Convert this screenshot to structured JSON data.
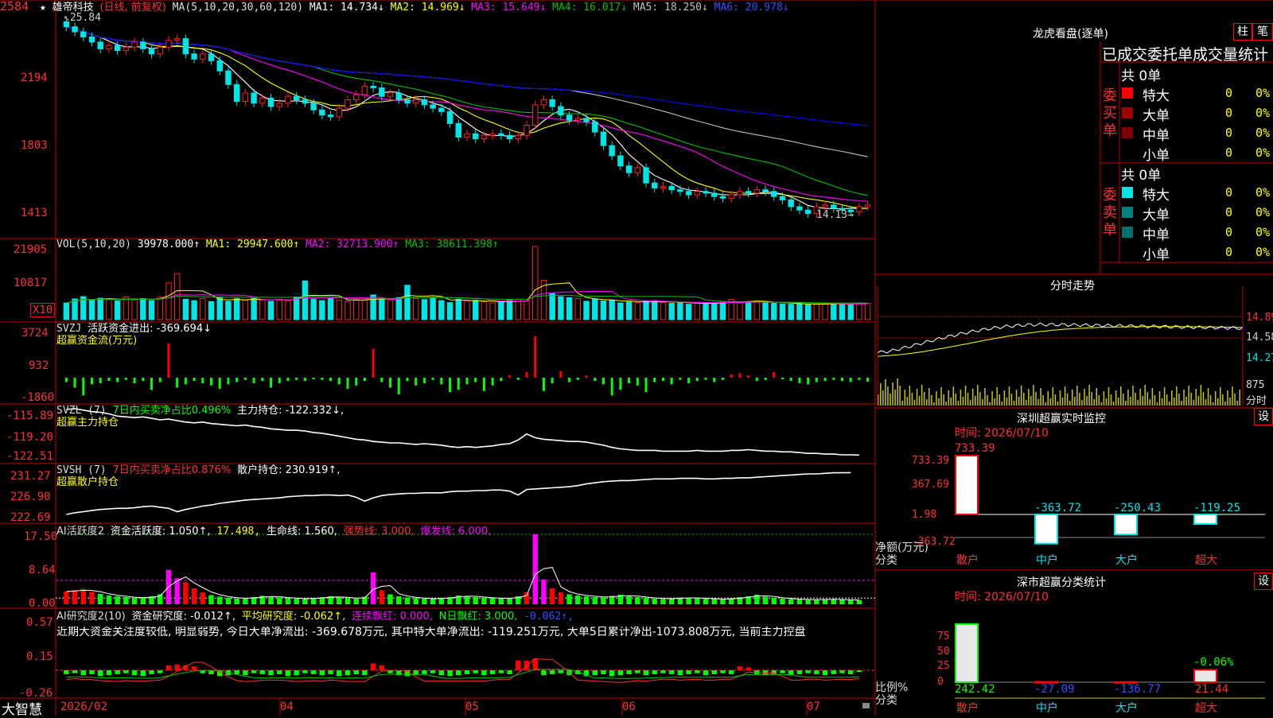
{
  "colors": {
    "up": "#ff2020",
    "down": "#00e5e5",
    "grid": "#c00000",
    "ma1": "#ffffff",
    "ma2": "#ffff00",
    "ma3": "#ff00ff",
    "ma4": "#00c000",
    "ma5": "#c0c0c0",
    "ma6": "#0000ff",
    "red_bar": "#ff0000",
    "green_bar": "#00ff00"
  },
  "icons": {
    "star": "star-icon",
    "close_tab": "close-icon",
    "lock": "lock-icon"
  },
  "kline": {
    "ticks": [
      "2584",
      "2194",
      "1803",
      "1413"
    ],
    "header": {
      "star": "★",
      "name": "雄帝科技",
      "mode": "(日线, 前复权)",
      "ma_def": "MA(5,10,20,30,60,120)",
      "ma1": "MA1: 14.734↓",
      "ma2": "MA2: 14.969↓",
      "ma3": "MA3: 15.649↓",
      "ma4": "MA4: 16.017↓",
      "ma5": "MA5: 18.250↓",
      "ma6": "MA6: 20.978↓"
    },
    "high_label": "25.84",
    "low_label": "14.13"
  },
  "vol": {
    "ticks": [
      "21905",
      "10817"
    ],
    "unit": "X10",
    "header": {
      "def": "VOL(5,10,20)",
      "val": "39978.000↑",
      "ma1": "MA1: 29947.600↑",
      "ma2": "MA2: 32713.900↑",
      "ma3": "MA3: 38611.398↑"
    }
  },
  "svzj": {
    "ticks": [
      "3724",
      "932",
      "-1860"
    ],
    "header": {
      "name": "SVZJ",
      "text": "活跃资金进出: -369.694↓"
    },
    "sub": "超赢资金流(万元)"
  },
  "svzl": {
    "ticks": [
      "-115.89",
      "-119.20",
      "-122.51"
    ],
    "header": {
      "name": "SVZL (7)",
      "ratio": "7日内买卖净占比0.496%",
      "text": "主力持仓: -122.332↓,"
    },
    "sub": "超赢主力持仓"
  },
  "svsh": {
    "ticks": [
      "231.27",
      "226.90",
      "222.69"
    ],
    "header": {
      "name": "SVSH (7)",
      "ratio": "7日内买卖净占比0.876%",
      "text": "散户持仓: 230.919↑,"
    },
    "sub": "超赢散户持仓"
  },
  "ai1": {
    "ticks": [
      "17.50",
      "8.64",
      "0.00"
    ],
    "header": {
      "name": "AI活跃度2",
      "a": "资金活跃度: 1.050↑,",
      "b": "17.498,",
      "c": "生命线: 1.560,",
      "d": "强势线: 3.000,",
      "e": "爆发线: 6.000,"
    }
  },
  "ai2": {
    "ticks": [
      "0.57",
      "0.15",
      "-0.26"
    ],
    "header": {
      "name": "AI研究度2(10)",
      "a": "资金研究度: -0.012↑,",
      "b": "平均研究度: -0.062↑,",
      "c": "连续飘红: 0.000,",
      "d": "N日飘红: 3.000,",
      "e": "-0.062↑,"
    },
    "comment": "近期大资金关注度较低, 明显弱势, 今日大单净流出: -369.678万元, 其中特大单净流出: -119.251万元, 大单5日累计净出-1073.808万元, 当前主力控盘"
  },
  "xaxis": {
    "brand": "大智慧",
    "labels": [
      "2026/02",
      "04",
      "05",
      "06",
      "07"
    ]
  },
  "right": {
    "top_title": "龙虎看盘(逐单)",
    "btn1": "柱",
    "btn2": "笔",
    "stat_title": "已成交委托单成交量统计",
    "buy": {
      "side": [
        "委",
        "买",
        "单"
      ],
      "total": "共 0单",
      "rows": [
        [
          "特大",
          "0",
          "0%"
        ],
        [
          "大单",
          "0",
          "0%"
        ],
        [
          "中单",
          "0",
          "0%"
        ],
        [
          "小单",
          "0",
          "0%"
        ]
      ]
    },
    "sell": {
      "side": [
        "委",
        "卖",
        "单"
      ],
      "total": "共 0单",
      "rows": [
        [
          "特大",
          "0",
          "0%"
        ],
        [
          "大单",
          "0",
          "0%"
        ],
        [
          "中单",
          "0",
          "0%"
        ],
        [
          "小单",
          "0",
          "0%"
        ]
      ]
    },
    "intraday": {
      "title": "分时走势",
      "ticks": [
        "14.89",
        "14.58",
        "14.27"
      ],
      "vol_tick": "875",
      "vol_unit": "分时"
    },
    "monitor": {
      "title": "深圳超赢实时监控",
      "btn": "设",
      "time": "时间: 2026/07/10",
      "ticks": [
        "733.39",
        "367.69",
        "1.98",
        "-363.72"
      ],
      "vals": [
        "733.39",
        "-363.72",
        "-250.43",
        "-119.25"
      ],
      "cats": [
        "散户",
        "中户",
        "大户",
        "超大"
      ],
      "ylab1": "净额(万元)",
      "ylab2": "分类"
    },
    "classify": {
      "title": "深市超赢分类统计",
      "btn": "设",
      "time": "时间: 2026/07/10",
      "ticks": [
        "75",
        "50",
        "25",
        "0"
      ],
      "vals": [
        "242.42",
        "-27.09",
        "-136.77",
        "21.44"
      ],
      "extra": "-0.06%",
      "cats": [
        "散户",
        "中户",
        "大户",
        "超大"
      ],
      "ylab1": "比例%",
      "ylab2": "分类"
    }
  },
  "chart_data": [
    {
      "type": "candlestick",
      "title": "雄帝科技",
      "ylim": [
        14.13,
        25.84
      ],
      "series": [
        {
          "name": "雄帝科技",
          "close": [
            25.2,
            24.9,
            24.6,
            24.3,
            23.9,
            24.1,
            23.8,
            24.0,
            24.3,
            23.9,
            23.6,
            24.0,
            24.4,
            24.5,
            23.6,
            23.3,
            23.6,
            23.2,
            22.6,
            21.8,
            20.8,
            21.3,
            20.7,
            21.0,
            20.5,
            20.7,
            21.1,
            20.9,
            20.7,
            20.3,
            20.0,
            19.9,
            20.4,
            20.9,
            21.2,
            21.7,
            21.6,
            21.1,
            21.3,
            20.9,
            20.7,
            20.9,
            20.6,
            20.4,
            20.2,
            19.5,
            18.7,
            18.9,
            18.6,
            18.8,
            18.9,
            18.8,
            18.6,
            18.8,
            19.4,
            20.6,
            20.9,
            20.5,
            20.0,
            19.7,
            19.8,
            19.6,
            19.0,
            18.2,
            17.6,
            17.0,
            16.6,
            16.9,
            16.0,
            15.7,
            15.8,
            15.6,
            15.5,
            15.3,
            15.5,
            15.4,
            15.2,
            15.1,
            15.3,
            15.5,
            15.4,
            15.6,
            15.5,
            15.2,
            15.0,
            14.6,
            14.4,
            14.2,
            14.6,
            14.7,
            14.5,
            14.4,
            14.3,
            14.6,
            14.7
          ]
        }
      ]
    },
    {
      "type": "bar",
      "title": "VOL(5,10,20)",
      "series": [
        {
          "name": "VOL",
          "values": [
            5000,
            6200,
            6900,
            5800,
            6400,
            6100,
            5600,
            6800,
            5900,
            6300,
            5700,
            6700,
            11000,
            13800,
            6100,
            5700,
            6300,
            5400,
            6700,
            5500,
            6300,
            5800,
            6400,
            5900,
            5500,
            6100,
            5700,
            6800,
            11600,
            6200,
            5700,
            6300,
            5900,
            5400,
            6000,
            5800,
            7400,
            6200,
            5900,
            6600,
            10300,
            6300,
            6000,
            6600,
            5700,
            5100,
            6100,
            5500,
            5800,
            5300,
            5000,
            5300,
            5800,
            6100,
            5600,
            21905,
            11800,
            7900,
            6900,
            6600,
            6300,
            5500,
            6100,
            5600,
            5900,
            5000,
            5300,
            5100,
            5500,
            5700,
            5200,
            4900,
            5000,
            4600,
            5200,
            4700,
            5000,
            5200,
            6100,
            5400,
            5300,
            5600,
            5100,
            4900,
            4700,
            4600,
            4800,
            4500,
            4600,
            4700,
            4900,
            4800,
            4600,
            4700,
            4900
          ]
        }
      ]
    },
    {
      "type": "bar",
      "title": "SVZJ",
      "series": [
        {
          "name": "活跃资金进出",
          "values": [
            -400,
            -900,
            -1600,
            -600,
            -500,
            -300,
            -400,
            -200,
            -500,
            -300,
            -1100,
            -400,
            3100,
            -900,
            -600,
            -300,
            -500,
            -700,
            -1000,
            -600,
            -400,
            -200,
            -500,
            -300,
            -900,
            -500,
            -300,
            -200,
            -300,
            -100,
            -200,
            -300,
            -600,
            -1000,
            -700,
            -300,
            2600,
            -400,
            -900,
            -1500,
            -300,
            -700,
            -500,
            -200,
            -600,
            -1300,
            -1100,
            -600,
            -400,
            -1200,
            -700,
            -300,
            200,
            -200,
            500,
            3724,
            -1200,
            -500,
            600,
            -400,
            -200,
            200,
            -300,
            -600,
            -1600,
            -1100,
            -500,
            -700,
            -1300,
            -400,
            -300,
            -600,
            -200,
            -500,
            -300,
            -200,
            -400,
            -200,
            300,
            400,
            200,
            -300,
            -200,
            500,
            -100,
            -300,
            -500,
            -600,
            -400,
            -300,
            -200,
            -300,
            -400,
            -200,
            -370
          ]
        }
      ]
    },
    {
      "type": "line",
      "title": "SVZL (7)",
      "ylim": [
        -122.51,
        -115.89
      ],
      "series": [
        {
          "name": "主力持仓",
          "values": [
            -116.2,
            -116.1,
            -116.3,
            -116.5,
            -116.6,
            -116.8,
            -117.1,
            -117.2,
            -117.3,
            -117.2,
            -117.4,
            -117.6,
            -117.5,
            -117.7,
            -117.9,
            -118.0,
            -117.9,
            -118.1,
            -118.2,
            -118.3,
            -118.4,
            -118.3,
            -118.5,
            -118.6,
            -118.8,
            -118.9,
            -119.0,
            -119.0,
            -119.1,
            -119.3,
            -119.4,
            -119.6,
            -119.8,
            -120.0,
            -120.2,
            -120.3,
            -120.5,
            -120.6,
            -120.7,
            -120.7,
            -120.8,
            -120.9,
            -120.8,
            -120.9,
            -121.0,
            -121.2,
            -121.3,
            -121.2,
            -121.3,
            -121.2,
            -121.1,
            -120.9,
            -120.8,
            -120.3,
            -119.5,
            -120.0,
            -120.2,
            -120.3,
            -120.4,
            -120.5,
            -120.5,
            -120.6,
            -120.8,
            -121.0,
            -121.3,
            -121.5,
            -121.6,
            -121.7,
            -121.7,
            -121.7,
            -121.8,
            -121.8,
            -121.8,
            -121.8,
            -121.7,
            -121.8,
            -121.8,
            -121.8,
            -121.7,
            -121.7,
            -121.6,
            -121.7,
            -121.8,
            -121.8,
            -121.9,
            -121.9,
            -122.0,
            -122.1,
            -122.1,
            -122.2,
            -122.2,
            -122.3,
            -122.3,
            -122.33
          ]
        }
      ]
    },
    {
      "type": "line",
      "title": "SVSH (7)",
      "ylim": [
        222.69,
        231.27
      ],
      "series": [
        {
          "name": "散户持仓",
          "values": [
            223.4,
            223.7,
            223.9,
            224.1,
            224.3,
            224.4,
            224.5,
            224.5,
            224.6,
            224.8,
            224.9,
            224.7,
            224.5,
            223.9,
            224.3,
            224.6,
            224.9,
            225.1,
            225.4,
            225.6,
            225.8,
            226.0,
            226.1,
            226.2,
            226.3,
            226.4,
            226.6,
            226.7,
            226.8,
            226.8,
            226.9,
            226.9,
            226.8,
            226.9,
            226.5,
            225.8,
            226.4,
            226.8,
            227.0,
            227.1,
            227.2,
            227.2,
            227.3,
            227.3,
            227.3,
            227.5,
            227.6,
            227.6,
            227.7,
            227.7,
            227.8,
            227.8,
            227.6,
            226.9,
            227.9,
            228.0,
            228.1,
            228.2,
            228.3,
            228.4,
            228.6,
            228.9,
            229.1,
            229.3,
            229.4,
            229.5,
            229.5,
            229.6,
            229.7,
            229.8,
            229.8,
            229.8,
            229.9,
            229.9,
            229.9,
            229.8,
            229.8,
            229.9,
            229.9,
            230.0,
            230.0,
            230.1,
            230.2,
            230.3,
            230.4,
            230.5,
            230.6,
            230.7,
            230.7,
            230.8,
            230.9,
            230.9,
            230.92
          ]
        }
      ]
    },
    {
      "type": "bar",
      "title": "AI活跃度2",
      "ylim": [
        0,
        17.5
      ],
      "series": [
        {
          "name": "资金活跃度",
          "values": [
            3.2,
            3.5,
            3.8,
            3.1,
            2.6,
            2.2,
            2.0,
            1.8,
            1.5,
            1.7,
            2.0,
            2.5,
            8.6,
            6.5,
            5.5,
            4.0,
            3.0,
            2.3,
            1.9,
            1.6,
            1.4,
            1.5,
            1.8,
            2.1,
            1.9,
            1.7,
            1.5,
            1.4,
            1.3,
            1.6,
            1.8,
            2.0,
            1.7,
            1.5,
            1.4,
            1.9,
            8.0,
            3.5,
            2.5,
            2.0,
            1.7,
            1.5,
            1.4,
            1.3,
            1.6,
            1.8,
            2.2,
            2.0,
            1.8,
            1.6,
            1.5,
            1.4,
            1.6,
            2.0,
            3.0,
            17.5,
            6.2,
            4.0,
            3.0,
            2.5,
            2.2,
            2.0,
            1.8,
            1.7,
            2.1,
            2.4,
            2.0,
            1.8,
            1.6,
            1.4,
            1.3,
            1.5,
            1.7,
            1.6,
            1.5,
            1.4,
            1.3,
            1.2,
            1.5,
            1.8,
            2.0,
            2.4,
            1.9,
            1.6,
            1.4,
            1.3,
            1.2,
            1.1,
            1.2,
            1.3,
            1.2,
            1.1,
            1.1,
            1.05
          ]
        }
      ]
    },
    {
      "type": "bar",
      "title": "AI研究度2(10)",
      "ylim": [
        -0.26,
        0.57
      ],
      "series": [
        {
          "name": "资金研究度",
          "values": [
            -0.04,
            -0.03,
            -0.05,
            -0.04,
            -0.06,
            -0.05,
            -0.04,
            -0.03,
            -0.05,
            -0.06,
            -0.04,
            -0.03,
            0.05,
            0.06,
            0.05,
            0.04,
            -0.03,
            -0.04,
            -0.06,
            -0.05,
            -0.04,
            -0.05,
            -0.03,
            -0.04,
            -0.05,
            -0.04,
            -0.06,
            -0.05,
            -0.03,
            -0.04,
            -0.05,
            -0.04,
            -0.06,
            -0.05,
            -0.04,
            -0.05,
            0.07,
            0.05,
            -0.03,
            -0.05,
            -0.06,
            -0.05,
            -0.04,
            -0.03,
            -0.05,
            -0.06,
            -0.05,
            -0.04,
            -0.03,
            -0.05,
            -0.04,
            -0.03,
            -0.04,
            0.1,
            0.1,
            0.12,
            -0.05,
            -0.04,
            -0.03,
            -0.05,
            -0.04,
            -0.06,
            -0.05,
            -0.04,
            -0.06,
            -0.05,
            -0.04,
            -0.03,
            -0.05,
            -0.04,
            -0.03,
            -0.04,
            -0.05,
            -0.04,
            -0.03,
            -0.05,
            -0.04,
            -0.03,
            -0.04,
            0.04,
            0.03,
            -0.04,
            -0.05,
            -0.04,
            -0.03,
            -0.05,
            -0.04,
            -0.03,
            -0.04,
            -0.05,
            -0.04,
            -0.03,
            -0.04,
            -0.012
          ]
        }
      ]
    }
  ]
}
